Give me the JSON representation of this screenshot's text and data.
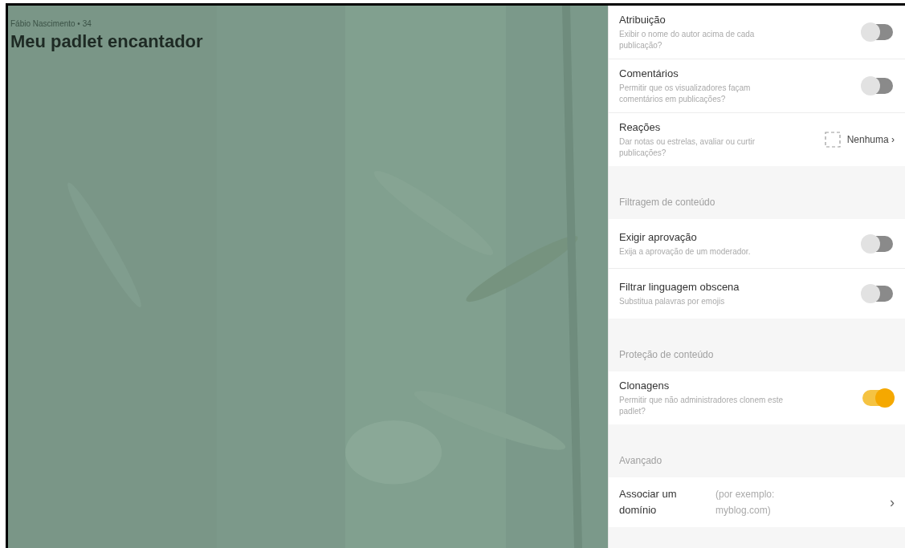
{
  "board": {
    "author": "Fábio Nascimento • 34",
    "title": "Meu padlet encantador"
  },
  "settings": [
    {
      "kind": "toggle",
      "title": "Atribuição",
      "description": "Exibir o nome do autor acima de cada publicação?",
      "on": false
    },
    {
      "kind": "toggle",
      "title": "Comentários",
      "description": "Permitir que os visualizadores façam comentários em publicações?",
      "on": false
    },
    {
      "kind": "select",
      "title": "Reações",
      "description": "Dar notas ou estrelas, avaliar ou curtir publicações?",
      "value": "Nenhuma",
      "chevron": "›"
    },
    {
      "kind": "section",
      "title": "Filtragem de conteúdo"
    },
    {
      "kind": "toggle",
      "title": "Exigir aprovação",
      "description": "Exija a aprovação de um moderador.",
      "on": false
    },
    {
      "kind": "toggle",
      "title": "Filtrar linguagem obscena",
      "description": "Substitua palavras por emojis",
      "on": false
    },
    {
      "kind": "section",
      "title": "Proteção de conteúdo"
    },
    {
      "kind": "toggle",
      "title": "Clonagens",
      "description": "Permitir que não administradores clonem este padlet?",
      "on": true
    },
    {
      "kind": "section",
      "title": "Avançado"
    },
    {
      "kind": "link",
      "title": "Associar um domínio",
      "placeholder": "(por exemplo: myblog.com)",
      "chevron": "›"
    }
  ]
}
